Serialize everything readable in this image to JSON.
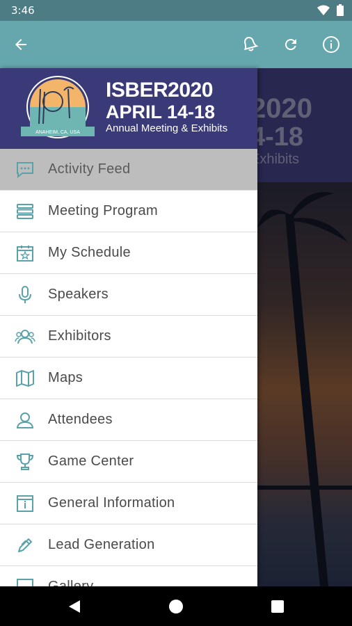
{
  "status_bar": {
    "time": "3:46"
  },
  "toolbar": {
    "back_icon": "arrow-left-icon",
    "bell_icon": "bell-icon",
    "refresh_icon": "refresh-icon",
    "info_icon": "info-icon"
  },
  "header": {
    "brand_title": "ISBER2020",
    "dates": "APRIL 14-18",
    "subtitle": "Annual Meeting & Exhibits",
    "logo_location": "ANAHEIM, CA, USA"
  },
  "background": {
    "title_partial": "2020",
    "dates_partial": "4-18",
    "subtitle_partial": "Exhibits"
  },
  "menu": {
    "items": [
      {
        "label": "Activity Feed",
        "icon": "chat-icon",
        "active": true
      },
      {
        "label": "Meeting Program",
        "icon": "stack-icon",
        "active": false
      },
      {
        "label": "My Schedule",
        "icon": "calendar-star-icon",
        "active": false
      },
      {
        "label": "Speakers",
        "icon": "microphone-icon",
        "active": false
      },
      {
        "label": "Exhibitors",
        "icon": "people-icon",
        "active": false
      },
      {
        "label": "Maps",
        "icon": "map-icon",
        "active": false
      },
      {
        "label": "Attendees",
        "icon": "person-icon",
        "active": false
      },
      {
        "label": "Game Center",
        "icon": "trophy-icon",
        "active": false
      },
      {
        "label": "General Information",
        "icon": "info-box-icon",
        "active": false
      },
      {
        "label": "Lead Generation",
        "icon": "pen-icon",
        "active": false
      },
      {
        "label": "Gallery",
        "icon": "gallery-icon",
        "active": false
      }
    ]
  },
  "colors": {
    "toolbar": "#65a7ad",
    "status_bar": "#4e7c84",
    "header": "#3a3a78",
    "icon_teal": "#5aa2aa"
  }
}
